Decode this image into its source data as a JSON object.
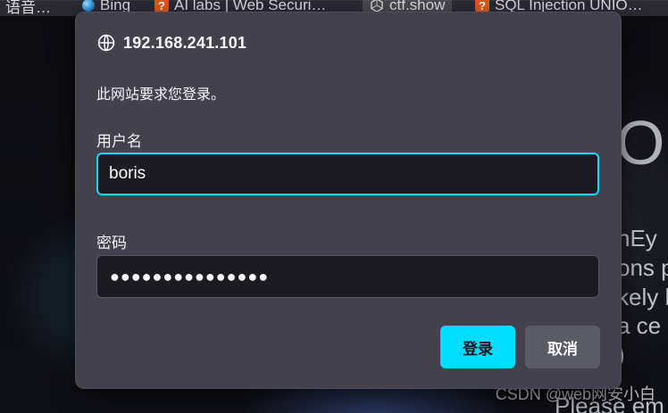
{
  "browser": {
    "bookmarks_bar": [
      {
        "label": "语音…",
        "icon": "none"
      },
      {
        "label": "Bing",
        "icon": "bing-icon"
      },
      {
        "label": "AI labs | Web Securi…",
        "icon": "ai-labs-icon"
      },
      {
        "label": "ctf.show",
        "icon": "ctfshow-icon"
      },
      {
        "label": "SQL Injection UNIO…",
        "icon": "ai-labs-icon"
      }
    ]
  },
  "background_page": {
    "big_letter": "O",
    "lines": [
      "nEy",
      "ons p",
      "kely h",
      "a ce",
      ")",
      "Please em"
    ]
  },
  "dialog": {
    "host": "192.168.241.101",
    "message": "此网站要求您登录。",
    "username_label": "用户名",
    "username_value": "boris",
    "password_label": "密码",
    "password_masked": "●●●●●●●●●●●●●●●",
    "login_button": "登录",
    "cancel_button": "取消",
    "colors": {
      "dialog_bg": "#42414d",
      "field_bg": "#1c1b22",
      "accent": "#00ddff",
      "secondary_button": "#5b5b66"
    }
  },
  "watermark": {
    "text": "CSDN @web网安小白"
  }
}
